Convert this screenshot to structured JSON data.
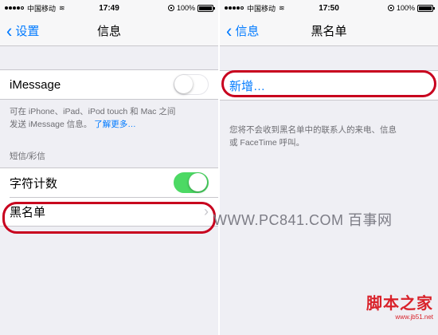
{
  "left": {
    "status": {
      "carrier": "中国移动",
      "time": "17:49",
      "battery": "100%"
    },
    "nav": {
      "back": "设置",
      "title": "信息"
    },
    "imessage": {
      "label": "iMessage",
      "enabled": false
    },
    "imessage_footnote": {
      "line1": "可在 iPhone、iPad、iPod touch 和 Mac 之间",
      "line2": "发送 iMessage 信息。",
      "link": "了解更多…"
    },
    "sms_section": {
      "header": "短信/彩信"
    },
    "char_count": {
      "label": "字符计数",
      "enabled": true
    },
    "blacklist": {
      "label": "黑名单"
    }
  },
  "right": {
    "status": {
      "carrier": "中国移动",
      "time": "17:50",
      "battery": "100%"
    },
    "nav": {
      "back": "信息",
      "title": "黑名单"
    },
    "add": {
      "label": "新增…"
    },
    "description": {
      "line1": "您将不会收到黑名单中的联系人的来电、信息",
      "line2": "或 FaceTime 呼叫。"
    }
  },
  "watermark": {
    "text": "WWW.PC841.COM 百事网",
    "logo_text": "脚本之家",
    "logo_url": "www.jb51.net"
  },
  "colors": {
    "ios_blue": "#007aff",
    "switch_on": "#4cd964",
    "highlight_red": "#c8001e"
  }
}
